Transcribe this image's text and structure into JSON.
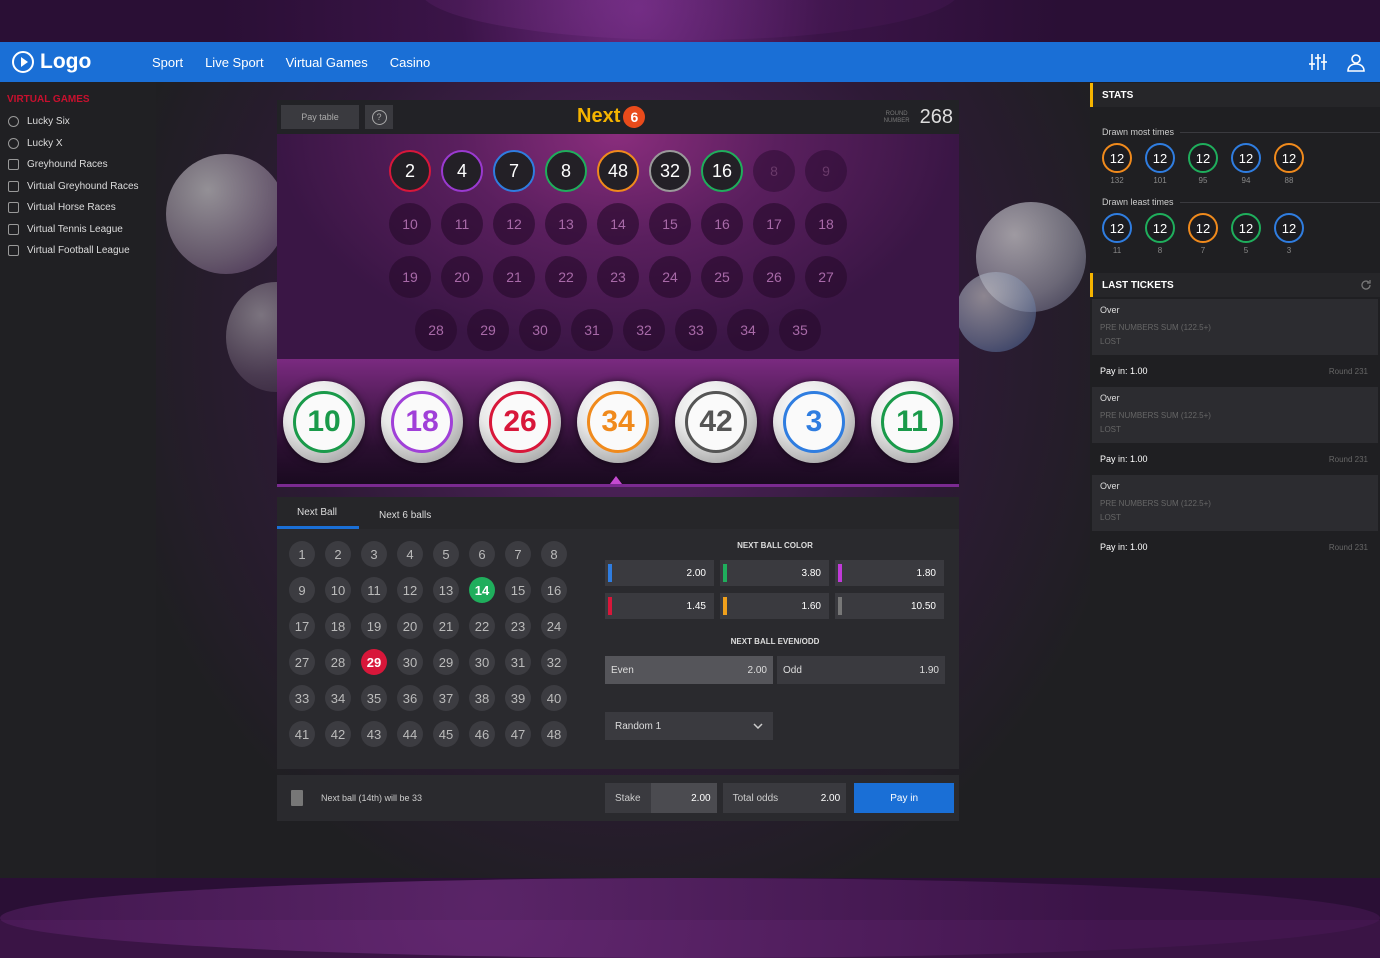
{
  "header": {
    "logo_text": "Logo",
    "nav": [
      "Sport",
      "Live Sport",
      "Virtual Games",
      "Casino"
    ]
  },
  "sidebar": {
    "title": "VIRTUAL GAMES",
    "items": [
      {
        "label": "Lucky Six",
        "icon": "ball-icon"
      },
      {
        "label": "Lucky X",
        "icon": "ball-icon"
      },
      {
        "label": "Greyhound Races",
        "icon": "greyhound-icon"
      },
      {
        "label": "Virtual Greyhound Races",
        "icon": "greyhound-icon"
      },
      {
        "label": "Virtual Horse Races",
        "icon": "horse-icon"
      },
      {
        "label": "Virtual Tennis League",
        "icon": "tennis-icon"
      },
      {
        "label": "Virtual Football League",
        "icon": "football-icon"
      }
    ]
  },
  "game": {
    "pay_table_label": "Pay table",
    "info_label": "?",
    "title": "Next",
    "title_badge": "6",
    "round_label": "ROUND NUMBER",
    "round_number": "268",
    "board_rows": [
      [
        {
          "n": "2",
          "c": "#d8173a",
          "s": "drawn"
        },
        {
          "n": "4",
          "c": "#9a3ad0",
          "s": "drawn"
        },
        {
          "n": "7",
          "c": "#2f7de0",
          "s": "drawn"
        },
        {
          "n": "8",
          "c": "#1fae5c",
          "s": "drawn"
        },
        {
          "n": "48",
          "c": "#f08a1c",
          "s": "drawn"
        },
        {
          "n": "32",
          "c": "#9a9a9a",
          "s": "drawn"
        },
        {
          "n": "16",
          "c": "#1fae5c",
          "s": "drawn"
        },
        {
          "n": "8",
          "c": "",
          "s": "dim"
        },
        {
          "n": "9",
          "c": "",
          "s": "dim"
        }
      ],
      [
        {
          "n": "10"
        },
        {
          "n": "11"
        },
        {
          "n": "12"
        },
        {
          "n": "13"
        },
        {
          "n": "14"
        },
        {
          "n": "15"
        },
        {
          "n": "16"
        },
        {
          "n": "17"
        },
        {
          "n": "18"
        }
      ],
      [
        {
          "n": "19"
        },
        {
          "n": "20"
        },
        {
          "n": "21"
        },
        {
          "n": "22"
        },
        {
          "n": "23"
        },
        {
          "n": "24"
        },
        {
          "n": "25"
        },
        {
          "n": "26"
        },
        {
          "n": "27"
        }
      ],
      [
        {
          "n": "28"
        },
        {
          "n": "29"
        },
        {
          "n": "30"
        },
        {
          "n": "31"
        },
        {
          "n": "32"
        },
        {
          "n": "33"
        },
        {
          "n": "34"
        },
        {
          "n": "35"
        }
      ]
    ],
    "big_balls": [
      {
        "n": "10",
        "c": "#1a9a4a"
      },
      {
        "n": "18",
        "c": "#a040d8"
      },
      {
        "n": "26",
        "c": "#d8173a"
      },
      {
        "n": "34",
        "c": "#f08a1c"
      },
      {
        "n": "42",
        "c": "#555555"
      },
      {
        "n": "3",
        "c": "#2f7de0"
      },
      {
        "n": "11",
        "c": "#1a9a4a"
      }
    ]
  },
  "tabs": [
    "Next Ball",
    "Next 6 balls"
  ],
  "number_grid": {
    "rows": [
      [
        "1",
        "2",
        "3",
        "4",
        "5",
        "6",
        "7",
        "8"
      ],
      [
        "9",
        "10",
        "11",
        "12",
        "13",
        "14",
        "15",
        "16"
      ],
      [
        "17",
        "18",
        "19",
        "20",
        "21",
        "22",
        "23",
        "24"
      ],
      [
        "27",
        "28",
        "29",
        "30",
        "29",
        "30",
        "31",
        "32"
      ],
      [
        "33",
        "34",
        "35",
        "36",
        "37",
        "38",
        "39",
        "40"
      ],
      [
        "41",
        "42",
        "43",
        "44",
        "45",
        "46",
        "47",
        "48"
      ]
    ],
    "selected_green": "14",
    "selected_red": "29"
  },
  "next_ball_color": {
    "title": "NEXT BALL COLOR",
    "odds": [
      {
        "value": "2.00",
        "color": "#2f7de0"
      },
      {
        "value": "3.80",
        "color": "#1fae5c"
      },
      {
        "value": "1.80",
        "color": "#c03ad8"
      },
      {
        "value": "1.45",
        "color": "#d8173a"
      },
      {
        "value": "1.60",
        "color": "#f0a01c"
      },
      {
        "value": "10.50",
        "color": "#777777"
      }
    ]
  },
  "even_odd": {
    "title": "NEXT BALL EVEN/ODD",
    "even_label": "Even",
    "even_odds": "2.00",
    "odd_label": "Odd",
    "odd_odds": "1.90"
  },
  "random_select": "Random 1",
  "bet": {
    "info": "Next ball (14th) will be 33",
    "stake_label": "Stake",
    "stake_value": "2.00",
    "total_odds_label": "Total odds",
    "total_odds_value": "2.00",
    "pay_in_label": "Pay in"
  },
  "stats": {
    "title": "STATS",
    "most_label": "Drawn most times",
    "most": [
      {
        "n": "12",
        "count": "132",
        "c": "#f08a1c"
      },
      {
        "n": "12",
        "count": "101",
        "c": "#2f7de0"
      },
      {
        "n": "12",
        "count": "95",
        "c": "#1fae5c"
      },
      {
        "n": "12",
        "count": "94",
        "c": "#2f7de0"
      },
      {
        "n": "12",
        "count": "88",
        "c": "#f08a1c"
      }
    ],
    "least_label": "Drawn least times",
    "least": [
      {
        "n": "12",
        "count": "11",
        "c": "#2f7de0"
      },
      {
        "n": "12",
        "count": "8",
        "c": "#1fae5c"
      },
      {
        "n": "12",
        "count": "7",
        "c": "#f08a1c"
      },
      {
        "n": "12",
        "count": "5",
        "c": "#1fae5c"
      },
      {
        "n": "12",
        "count": "3",
        "c": "#2f7de0"
      }
    ]
  },
  "last_tickets": {
    "title": "LAST TICKETS",
    "tickets": [
      {
        "type": "Over",
        "desc": "PRE NUMBERS SUM (122.5+)",
        "status": "LOST",
        "pay": "Pay in: 1.00",
        "round": "Round 231"
      },
      {
        "type": "Over",
        "desc": "PRE NUMBERS SUM (122.5+)",
        "status": "LOST",
        "pay": "Pay in: 1.00",
        "round": "Round 231"
      },
      {
        "type": "Over",
        "desc": "PRE NUMBERS SUM (122.5+)",
        "status": "LOST",
        "pay": "Pay in: 1.00",
        "round": "Round 231"
      }
    ]
  }
}
